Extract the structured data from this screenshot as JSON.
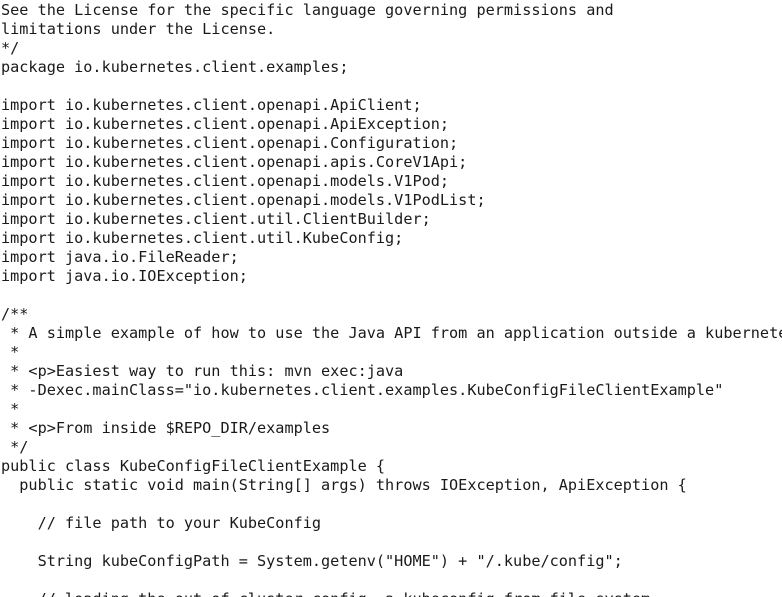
{
  "editor": {
    "lines": [
      "See the License for the specific language governing permissions and",
      "limitations under the License.",
      "*/",
      "package io.kubernetes.client.examples;",
      "",
      "import io.kubernetes.client.openapi.ApiClient;",
      "import io.kubernetes.client.openapi.ApiException;",
      "import io.kubernetes.client.openapi.Configuration;",
      "import io.kubernetes.client.openapi.apis.CoreV1Api;",
      "import io.kubernetes.client.openapi.models.V1Pod;",
      "import io.kubernetes.client.openapi.models.V1PodList;",
      "import io.kubernetes.client.util.ClientBuilder;",
      "import io.kubernetes.client.util.KubeConfig;",
      "import java.io.FileReader;",
      "import java.io.IOException;",
      "",
      "/**",
      " * A simple example of how to use the Java API from an application outside a kubernetes",
      " *",
      " * <p>Easiest way to run this: mvn exec:java",
      " * -Dexec.mainClass=\"io.kubernetes.client.examples.KubeConfigFileClientExample\"",
      " *",
      " * <p>From inside $REPO_DIR/examples",
      " */",
      "public class KubeConfigFileClientExample {",
      "  public static void main(String[] args) throws IOException, ApiException {",
      "",
      "    // file path to your KubeConfig",
      "",
      "    String kubeConfigPath = System.getenv(\"HOME\") + \"/.kube/config\";",
      "",
      "    // loading the out-of-cluster config, a kubeconfig from file-system"
    ]
  }
}
